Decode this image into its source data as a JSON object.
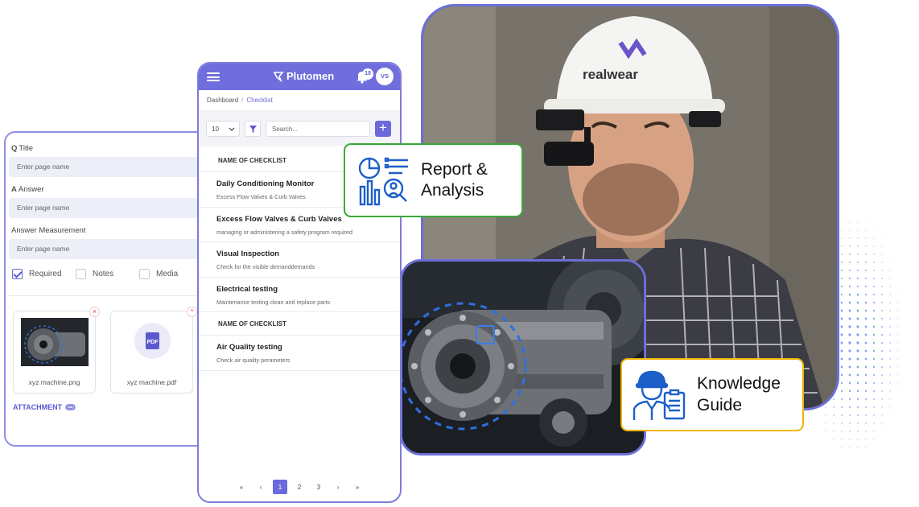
{
  "form": {
    "title_prefix": "Q",
    "title_label": "Title",
    "title_placeholder": "Enter page name",
    "answer_prefix": "A",
    "answer_label": "Answer",
    "answer_placeholder": "Enter page name",
    "measurement_label": "Answer Measurement",
    "measurement_placeholder": "Enter page name",
    "checks": [
      {
        "label": "Required",
        "checked": true
      },
      {
        "label": "Notes",
        "checked": false
      },
      {
        "label": "Media",
        "checked": false
      }
    ],
    "attachments": [
      {
        "name": "xyz machine.png"
      },
      {
        "name": "xyz machine.pdf",
        "icon_text": "PDF"
      }
    ],
    "attachment_label": "ATTACHMENT"
  },
  "phone": {
    "brand": "Plutomen",
    "notification_count": "10",
    "avatar_initials": "VS",
    "breadcrumb": [
      "Dashboard",
      "Checklist"
    ],
    "page_size": "10",
    "search_placeholder": "Search...",
    "section_1": "NAME OF CHECKLIST",
    "items_1": [
      {
        "title": "Daily Conditioning Monitor",
        "sub": "Excess Flow Valves & Curb Valves"
      },
      {
        "title": "Excess Flow Valves & Curb Valves",
        "sub": "managing or administering a safety program required"
      },
      {
        "title": "Visual Inspection",
        "sub": "Check for the visible demanddemands"
      },
      {
        "title": "Electrical testing",
        "sub": "Maintenance testing clean and replace parts"
      }
    ],
    "section_2": "NAME OF CHECKLIST",
    "items_2": [
      {
        "title": "Air Quality testing",
        "sub": "Check air quality perameters"
      }
    ],
    "pages": [
      "1",
      "2",
      "3"
    ],
    "current_page": "1"
  },
  "callouts": {
    "report_line1": "Report &",
    "report_line2": "Analysis",
    "guide_line1": "Knowledge",
    "guide_line2": "Guide"
  },
  "photo": {
    "helmet_text": "realwear"
  },
  "colors": {
    "accent": "#6f6edc",
    "report_border": "#3aa83a",
    "guide_border": "#f0b400",
    "icon_blue": "#1c5fc9"
  }
}
